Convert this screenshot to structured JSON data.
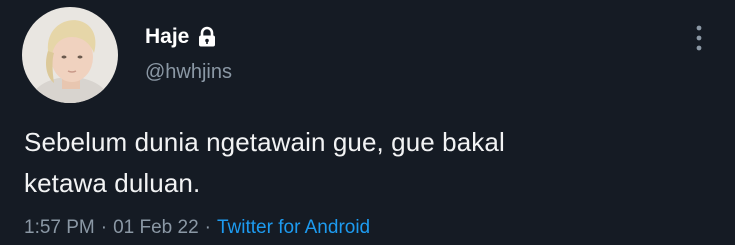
{
  "user": {
    "display_name": "Haje",
    "handle": "@hwhjins",
    "protected_icon": "lock-icon"
  },
  "tweet": {
    "text_line1": "Sebelum dunia ngetawain gue, gue bakal",
    "text_line2": "ketawa duluan.",
    "time": "1:57 PM",
    "separator": "·",
    "date": "01 Feb 22",
    "source": "Twitter for Android"
  },
  "icons": {
    "more": "more-vertical-icon"
  },
  "colors": {
    "background": "#151b24",
    "primary_text": "#f2f3f4",
    "secondary_text": "#8b98a5",
    "link": "#1d9bf0"
  }
}
